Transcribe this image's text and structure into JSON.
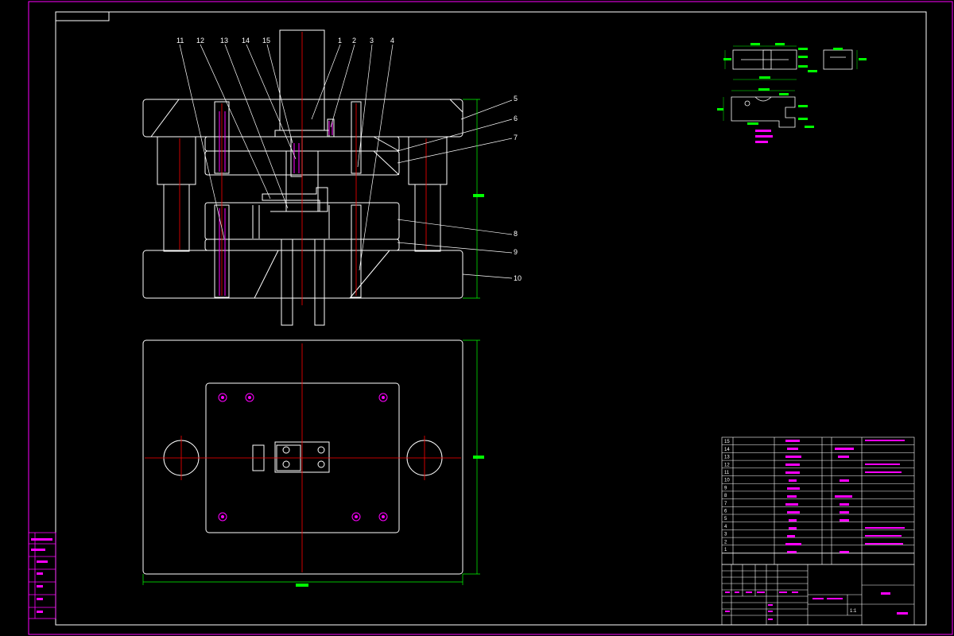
{
  "colors": {
    "frame": "#ff00ff",
    "inner_border": "#ffffff",
    "outline": "#ffffff",
    "centerline": "#ff0000",
    "dimension": "#00ff00",
    "text_magenta": "#ff00ff"
  },
  "callouts": {
    "top": [
      "11",
      "12",
      "13",
      "14",
      "15",
      "1",
      "2",
      "3",
      "4"
    ],
    "right": [
      "5",
      "6",
      "7",
      "8",
      "9",
      "10"
    ]
  },
  "bom": {
    "rows": [
      {
        "no": "15"
      },
      {
        "no": "14"
      },
      {
        "no": "13"
      },
      {
        "no": "12"
      },
      {
        "no": "11"
      },
      {
        "no": "10"
      },
      {
        "no": "9"
      },
      {
        "no": "8"
      },
      {
        "no": "7"
      },
      {
        "no": "6"
      },
      {
        "no": "5"
      },
      {
        "no": "4"
      },
      {
        "no": "3"
      },
      {
        "no": "2"
      },
      {
        "no": "1"
      }
    ]
  },
  "title_block": {
    "scale": "1:1"
  }
}
